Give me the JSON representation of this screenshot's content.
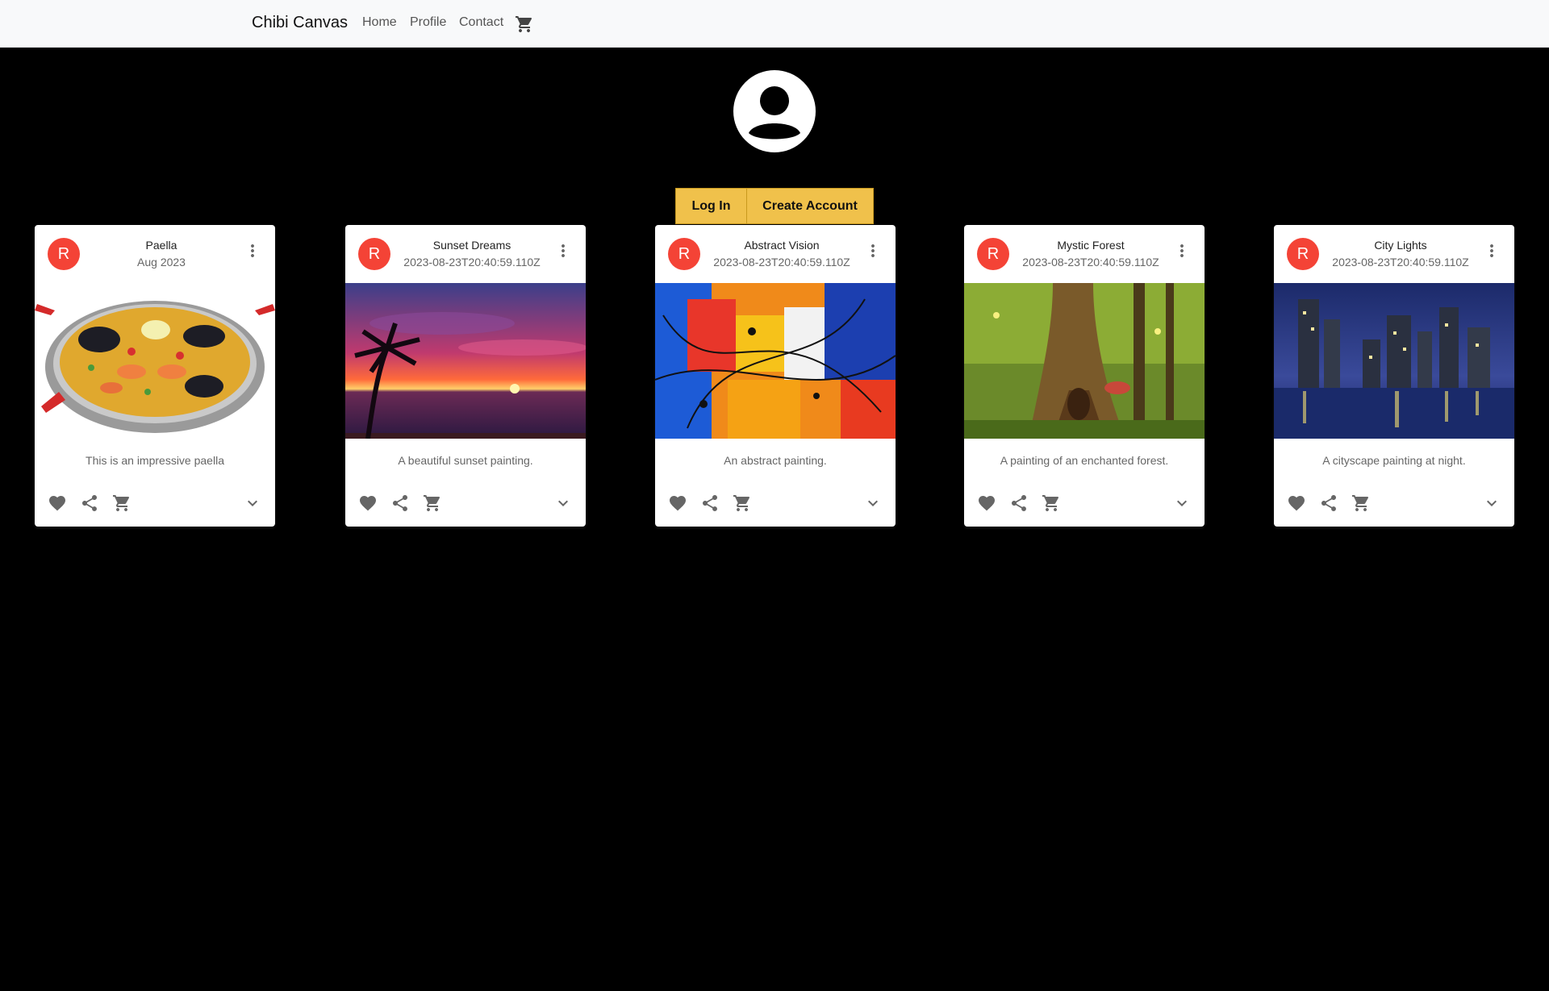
{
  "navbar": {
    "brand": "Chibi Canvas",
    "links": [
      "Home",
      "Profile",
      "Contact"
    ],
    "cart_icon": "cart-icon"
  },
  "profile": {
    "avatar_icon": "account-circle-icon",
    "login_label": "Log In",
    "create_label": "Create Account"
  },
  "colors": {
    "navbar_bg": "#f8f9fa",
    "page_bg": "#000000",
    "button_bg": "#f0c14b",
    "avatar_bg": "#f44336"
  },
  "cards": [
    {
      "initial": "R",
      "title": "Paella",
      "subheader": "Aug 2023",
      "description": "This is an impressive paella",
      "image": "paella-photo"
    },
    {
      "initial": "R",
      "title": "Sunset Dreams",
      "subheader": "2023-08-23T20:40:59.110Z",
      "description": "A beautiful sunset painting.",
      "image": "sunset-painting"
    },
    {
      "initial": "R",
      "title": "Abstract Vision",
      "subheader": "2023-08-23T20:40:59.110Z",
      "description": "An abstract painting.",
      "image": "abstract-painting"
    },
    {
      "initial": "R",
      "title": "Mystic Forest",
      "subheader": "2023-08-23T20:40:59.110Z",
      "description": "A painting of an enchanted forest.",
      "image": "forest-painting"
    },
    {
      "initial": "R",
      "title": "City Lights",
      "subheader": "2023-08-23T20:40:59.110Z",
      "description": "A cityscape painting at night.",
      "image": "city-painting"
    }
  ],
  "card_actions": [
    "favorite-icon",
    "share-icon",
    "add-to-cart-icon",
    "expand-more-icon"
  ]
}
